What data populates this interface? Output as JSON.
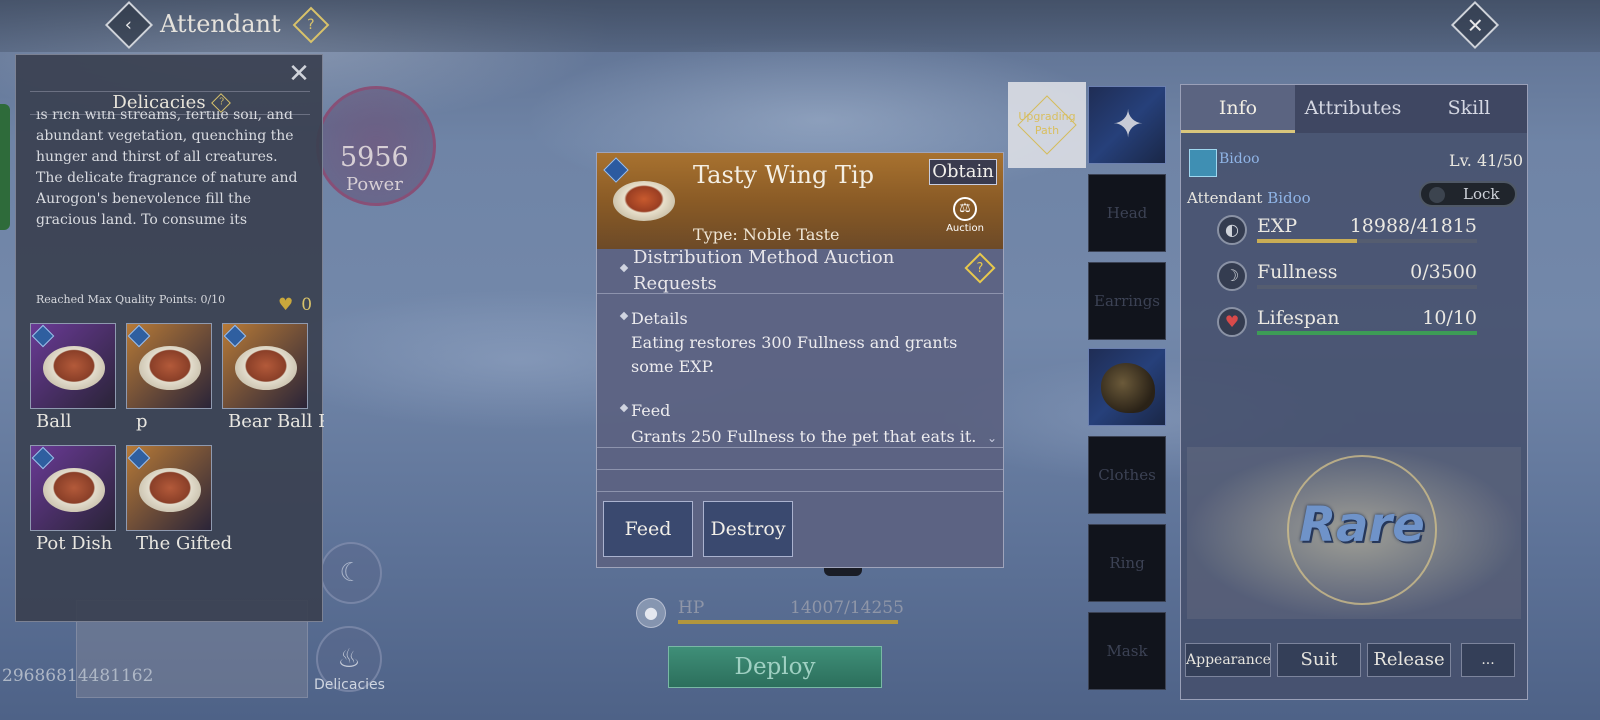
{
  "header": {
    "back_icon": "chevron-left-icon",
    "title": "Attendant",
    "help_icon": "question-icon",
    "close_icon": "crossed-swords-icon"
  },
  "background": {
    "id_text": "29686814481162"
  },
  "power": {
    "value": "5956",
    "label": "Power"
  },
  "side_buttons": {
    "delicacies_label": "Delicacies"
  },
  "delicacies_panel": {
    "title": "Delicacies",
    "description": "is rich with streams, fertile soil, and abundant vegetation, quenching the hunger and thirst of all creatures. The delicate fragrance of nature and Aurogon's benevolence fill the gracious land. To consume its",
    "quality_text": "Reached Max Quality Points: 0/10",
    "heart_count": "0",
    "items": [
      {
        "label": "Ball",
        "frame": "#6a3a96"
      },
      {
        "label": "p",
        "frame": "#b77a37"
      },
      {
        "label": "Bear Ball Po",
        "frame": "#b77a37"
      },
      {
        "label": "Pot Dish",
        "frame": "#6a3a96"
      },
      {
        "label": "The Gifted",
        "frame": "#b77a37"
      }
    ]
  },
  "item_popup": {
    "name": "Tasty Wing Tip",
    "obtain_label": "Obtain",
    "auction_label": "Auction",
    "type": "Type: Noble Taste",
    "distribution": "Distribution Method    Auction Requests",
    "details_title": "Details",
    "details_text": "Eating restores 300 Fullness and grants some EXP.",
    "feed_title": "Feed",
    "feed_text": "Grants 250 Fullness to the pet that eats it.",
    "feed_button": "Feed",
    "destroy_button": "Destroy"
  },
  "hp": {
    "label": "HP",
    "value": "14007/14255"
  },
  "deploy_label": "Deploy",
  "upgrade_label": "Upgrading Path",
  "equip_slots": [
    "Head",
    "Earrings",
    "Clothes",
    "Ring",
    "Mask"
  ],
  "info_panel": {
    "tabs": [
      "Info",
      "Attributes",
      "Skill"
    ],
    "pet_name": "Bidoo",
    "level": "Lv. 41/50",
    "attendant_label": "Attendant",
    "attendant_name": "Bidoo",
    "lock_label": "Lock",
    "stats": [
      {
        "name": "EXP",
        "value": "18988/41815",
        "fill": 0.454,
        "color": "#c9ad55"
      },
      {
        "name": "Fullness",
        "value": "0/3500",
        "fill": 0,
        "color": "#c9ad55"
      },
      {
        "name": "Lifespan",
        "value": "10/10",
        "fill": 1,
        "color": "#3d9c56"
      }
    ],
    "rarity": "Rare",
    "buttons": [
      "Appearance",
      "Suit",
      "Release",
      "..."
    ]
  }
}
